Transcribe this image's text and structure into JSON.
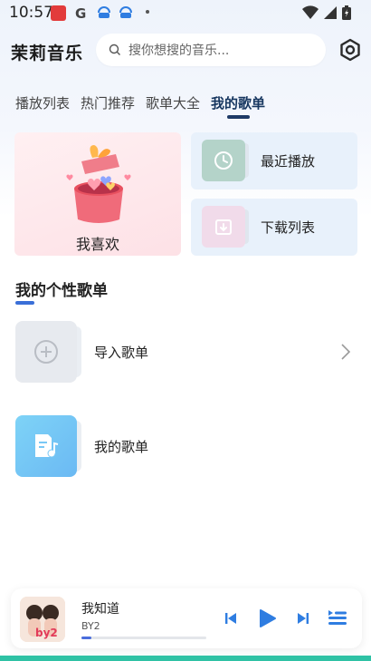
{
  "status": {
    "time": "10:57"
  },
  "header": {
    "app_title": "茉莉音乐",
    "search_placeholder": "搜你想搜的音乐..."
  },
  "tabs": [
    {
      "label": "播放列表"
    },
    {
      "label": "热门推荐"
    },
    {
      "label": "歌单大全"
    },
    {
      "label": "我的歌单",
      "active": true
    }
  ],
  "cards": {
    "favorite": "我喜欢",
    "recent": "最近播放",
    "downloads": "下载列表"
  },
  "section": {
    "title": "我的个性歌单"
  },
  "rows": [
    {
      "label": "导入歌单"
    },
    {
      "label": "我的歌单"
    }
  ],
  "player": {
    "song": "我知道",
    "artist": "BY2",
    "progress": 0.08
  },
  "colors": {
    "accent": "#2f7de1",
    "tab_active": "#16365f",
    "section_indicator": "#3a6fd8"
  }
}
